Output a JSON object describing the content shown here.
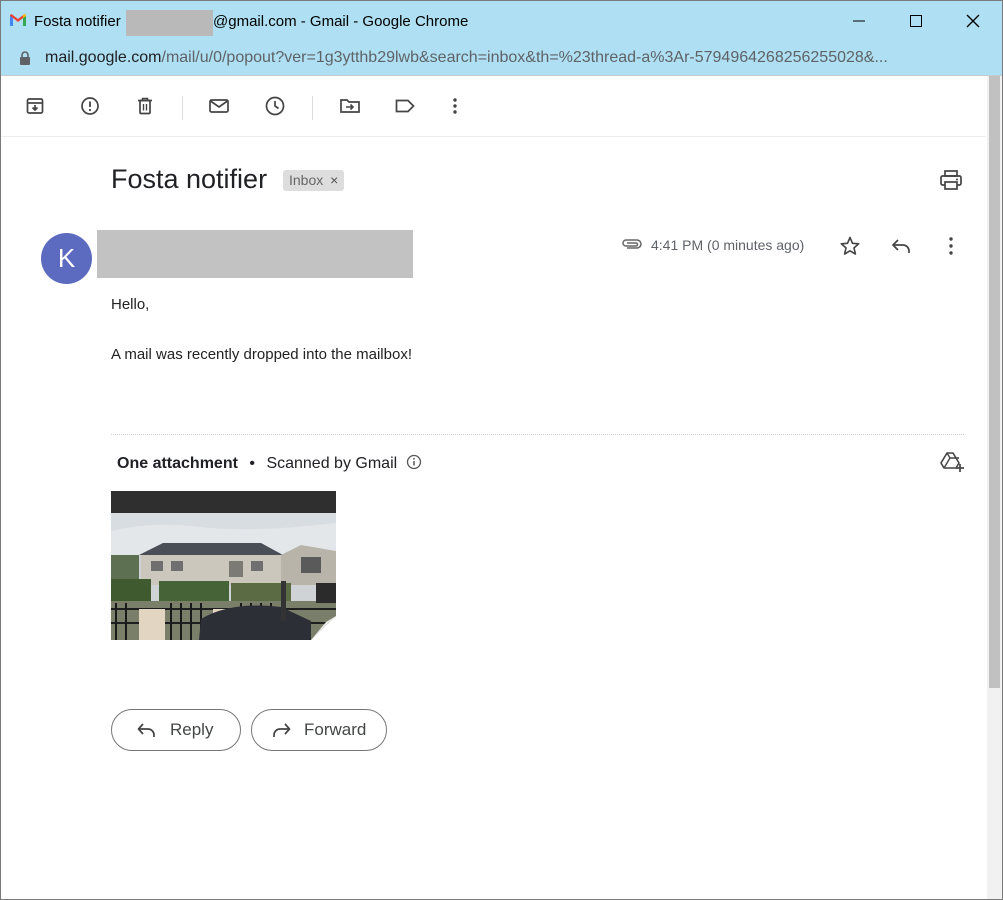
{
  "window": {
    "title_prefix": "Fosta notifier",
    "title_suffix": "@gmail.com - Gmail - Google Chrome",
    "controls": {
      "minimize_icon": "minimize-icon",
      "maximize_icon": "maximize-icon",
      "close_icon": "close-icon"
    }
  },
  "addressbar": {
    "host": "mail.google.com",
    "path": "/mail/u/0/popout?ver=1g3ytthb29lwb&search=inbox&th=%23thread-a%3Ar-5794964268256255028&..."
  },
  "toolbar": {
    "icons": [
      "archive-icon",
      "report-spam-icon",
      "delete-icon",
      "mark-unread-icon",
      "snooze-icon",
      "move-to-icon",
      "label-icon",
      "more-vert-icon"
    ]
  },
  "message": {
    "subject": "Fosta notifier",
    "label": "Inbox",
    "label_close": "×",
    "avatar_letter": "K",
    "time": "4:41 PM (0 minutes ago)",
    "greeting": "Hello,",
    "body": "A mail was recently dropped into the mailbox!"
  },
  "attachments": {
    "count_label": "One attachment",
    "bullet": "•",
    "scan_label": "Scanned by Gmail"
  },
  "actions": {
    "reply_label": "Reply",
    "forward_label": "Forward"
  },
  "colors": {
    "titlebar": "#aedff2",
    "avatar": "#5c6bc0"
  }
}
